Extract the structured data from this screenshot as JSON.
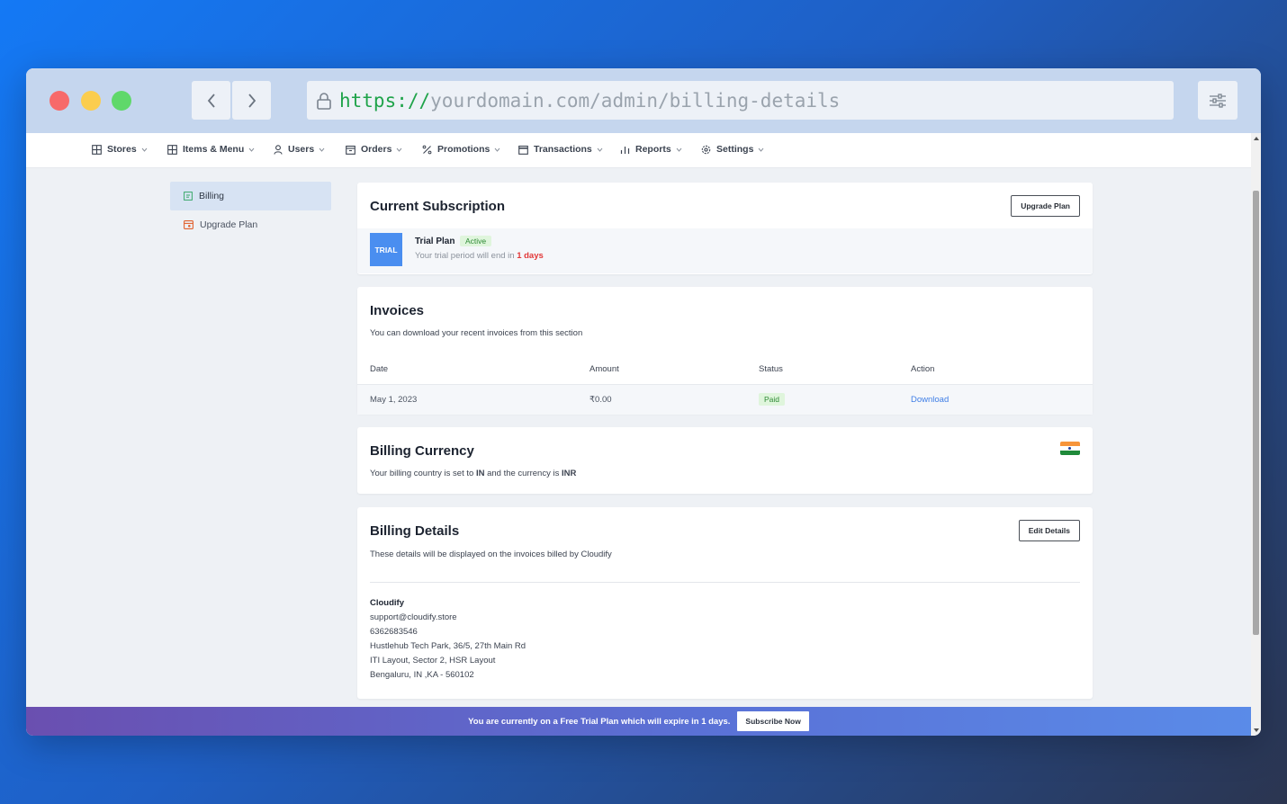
{
  "browser": {
    "url_scheme": "https://",
    "url_path": "yourdomain.com/admin/billing-details"
  },
  "nav": {
    "items": [
      {
        "label": "Stores",
        "icon": "grid-icon"
      },
      {
        "label": "Items & Menu",
        "icon": "grid-icon"
      },
      {
        "label": "Users",
        "icon": "user-icon"
      },
      {
        "label": "Orders",
        "icon": "box-icon"
      },
      {
        "label": "Promotions",
        "icon": "percent-icon"
      },
      {
        "label": "Transactions",
        "icon": "card-icon"
      },
      {
        "label": "Reports",
        "icon": "bar-chart-icon"
      },
      {
        "label": "Settings",
        "icon": "gear-icon"
      }
    ]
  },
  "sidebar": {
    "items": [
      {
        "label": "Billing",
        "active": true
      },
      {
        "label": "Upgrade Plan",
        "active": false
      }
    ]
  },
  "subscription": {
    "title": "Current Subscription",
    "upgrade_label": "Upgrade Plan",
    "badge": "TRIAL",
    "plan_name": "Trial Plan",
    "status": "Active",
    "note_prefix": "Your trial period will end in",
    "note_days": "1 days"
  },
  "invoices": {
    "title": "Invoices",
    "subtitle": "You can download your recent invoices from this section",
    "columns": [
      "Date",
      "Amount",
      "Status",
      "Action"
    ],
    "rows": [
      {
        "date": "May 1, 2023",
        "amount": "₹0.00",
        "status": "Paid",
        "action": "Download"
      }
    ]
  },
  "currency": {
    "title": "Billing Currency",
    "text_1": "Your billing country is set to",
    "country": "IN",
    "text_2": "and the currency is",
    "currency": "INR"
  },
  "billing_details": {
    "title": "Billing Details",
    "edit_label": "Edit Details",
    "subtitle": "These details will be displayed on the invoices billed by Cloudify",
    "company": "Cloudify",
    "email": "support@cloudify.store",
    "phone": "6362683546",
    "address_line1": "Hustlehub Tech Park, 36/5, 27th Main Rd",
    "address_line2": "ITI Layout, Sector 2, HSR Layout",
    "address_line3": "Bengaluru, IN ,KA - 560102"
  },
  "banner": {
    "text": "You are currently on a Free Trial Plan which will expire in 1 days.",
    "button": "Subscribe Now"
  },
  "colors": {
    "accent": "#4a8ef0",
    "success": "#2e8a35",
    "danger": "#e23838",
    "link": "#3f7ee6"
  }
}
